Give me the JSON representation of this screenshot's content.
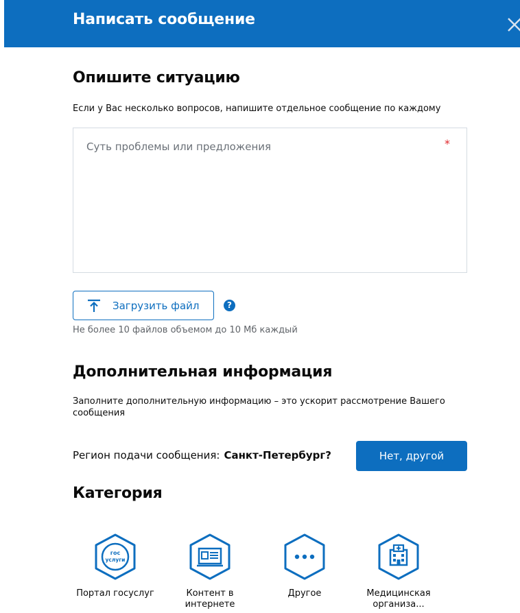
{
  "header": {
    "title": "Написать сообщение",
    "close_icon": "close-icon"
  },
  "situation": {
    "title": "Опишите ситуацию",
    "hint": "Если у Вас несколько вопросов, напишите отдельное сообщение по каждому",
    "placeholder": "Суть проблемы или предложения",
    "required_mark": "*"
  },
  "upload": {
    "button_label": "Загрузить файл",
    "icon": "upload-icon",
    "help": "?",
    "hint": "Не более 10 файлов объемом до 10 Мб каждый"
  },
  "additional": {
    "title": "Дополнительная информация",
    "hint": "Заполните дополнительную информацию – это ускорит рассмотрение Вашего сообщения"
  },
  "region": {
    "label": "Регион подачи сообщения:",
    "value": "Санкт-Петербург?",
    "button_label": "Нет, другой"
  },
  "category": {
    "title": "Категория",
    "items": [
      {
        "label": "Портал госуслуг",
        "icon": "gosuslugi-icon"
      },
      {
        "label": "Контент в интернете",
        "icon": "web-content-icon"
      },
      {
        "label": "Другое",
        "icon": "more-icon"
      },
      {
        "label": "Медицинская организа...",
        "icon": "hospital-icon"
      }
    ]
  },
  "colors": {
    "accent": "#0d6ebf",
    "required": "#e0262b",
    "border": "#d4dbe2"
  }
}
